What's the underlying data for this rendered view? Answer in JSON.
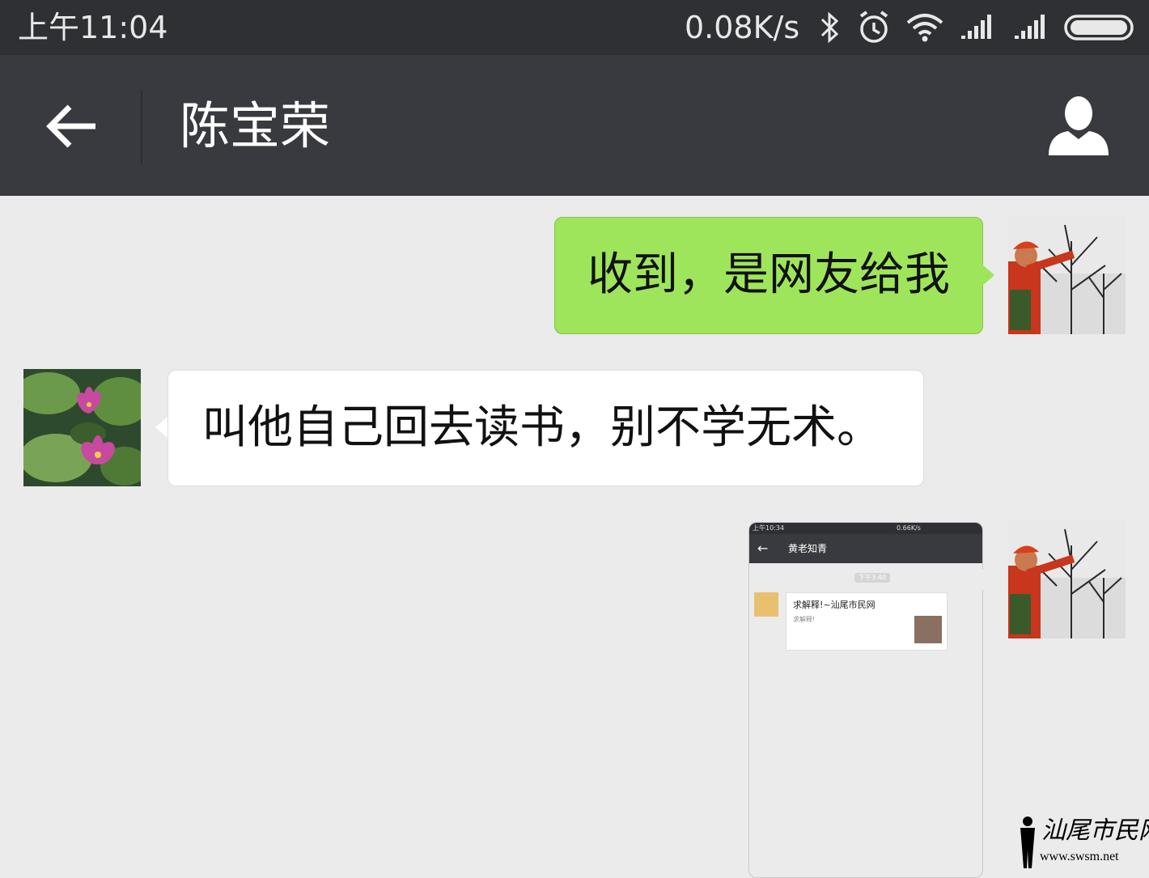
{
  "status_bar": {
    "time": "上午11:04",
    "network_speed": "0.08K/s",
    "icons": [
      "bluetooth-icon",
      "alarm-icon",
      "wifi-icon",
      "signal-icon",
      "signal-icon",
      "battery-icon"
    ]
  },
  "nav": {
    "back_icon": "arrow-left-icon",
    "title": "陈宝荣",
    "profile_icon": "person-icon"
  },
  "messages": [
    {
      "direction": "sent",
      "type": "text",
      "text": "收到，是网友给我",
      "avatar": "man-pointing-at-tree-photo"
    },
    {
      "direction": "received",
      "type": "text",
      "text": "叫他自己回去读书，别不学无术。",
      "avatar": "water-lily-photo"
    },
    {
      "direction": "sent",
      "type": "image",
      "avatar": "man-pointing-at-tree-photo",
      "screenshot": {
        "status_time": "上午10:34",
        "status_speed": "0.66K/s",
        "nav_title": "黄老知青",
        "time_pill": "下午3:40",
        "card_title": "求解释!~汕尾市民网",
        "card_subtitle": "求解释!"
      }
    }
  ],
  "watermark": {
    "site_name": "汕尾市民网",
    "url": "www.swsm.net"
  },
  "colors": {
    "status_bar_bg": "#2e3034",
    "nav_bg": "#393a3f",
    "chat_bg": "#ebebeb",
    "sent_bubble": "#9fe55b",
    "received_bubble": "#ffffff"
  }
}
